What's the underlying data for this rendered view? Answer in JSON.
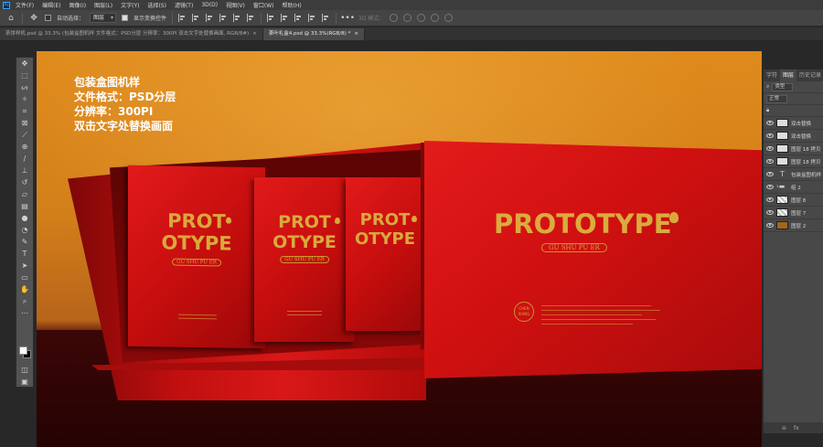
{
  "app": {
    "logo": "Ps"
  },
  "menu": [
    "文件(F)",
    "编辑(E)",
    "图像(I)",
    "图层(L)",
    "文字(Y)",
    "选择(S)",
    "滤镜(T)",
    "3D(D)",
    "视图(V)",
    "窗口(W)",
    "帮助(H)"
  ],
  "options": {
    "auto_select_label": "自动选择：",
    "auto_select_value": "图层",
    "show_transform_label": "显示变换控件",
    "mode_3d_label": "3D 模式："
  },
  "tabs": [
    {
      "label": "茶饼样机.psd @ 33.3% (包装盒图机样 文件格式：PSD分层 分辨率：300PI 双击文字处替换画面, RGB/8#)",
      "close": "×",
      "active": false
    },
    {
      "label": "茶叶礼盒4.psd @ 33.3%(RGB/8) *",
      "close": "×",
      "active": true
    }
  ],
  "overlay_text": [
    "包装盒图机样",
    "文件格式：PSD分层",
    "分辨率：300PI",
    "双击文字处替换画面"
  ],
  "product": {
    "title_line1": "PROT",
    "title_line2": "OTYPE",
    "title_full": "PROTOTYPE",
    "subtitle": "GU SHU PU ER",
    "stamp_text": [
      "CHEN",
      "XIANG"
    ]
  },
  "layers_panel": {
    "tabs": [
      "字符",
      "图层",
      "历史记录"
    ],
    "filter_value": "类型",
    "blend_value": "正常",
    "layers": [
      {
        "name": "双击替换",
        "thumb": "smart"
      },
      {
        "name": "双击替换",
        "thumb": "smart"
      },
      {
        "name": "图层 18 拷贝",
        "thumb": "smart"
      },
      {
        "name": "图层 18 拷贝",
        "thumb": "smart"
      },
      {
        "name": "包装盒图机样",
        "thumb": "text"
      },
      {
        "name": "组 2",
        "thumb": "folder"
      },
      {
        "name": "图层 8",
        "thumb": "checker"
      },
      {
        "name": "图层 7",
        "thumb": "checker"
      },
      {
        "name": "图层 2",
        "thumb": "brown"
      }
    ],
    "bottom_icons": [
      "link-icon",
      "fx-icon"
    ],
    "bottom_labels": [
      "⊖",
      "fx"
    ]
  }
}
